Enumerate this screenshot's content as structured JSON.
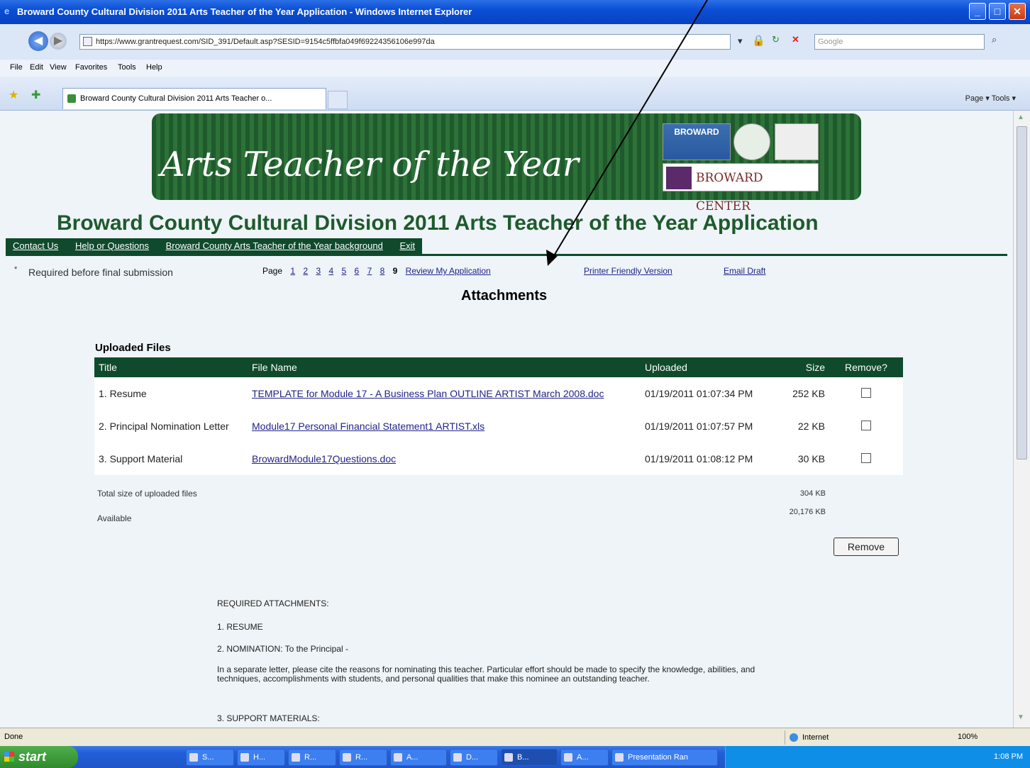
{
  "window": {
    "title": "Broward County Cultural Division 2011 Arts Teacher of the Year Application - Windows Internet Explorer",
    "minimize": "_",
    "maximize": "□",
    "close": "✕"
  },
  "browser": {
    "back": "◀",
    "forward": "▶",
    "url": "https://www.grantrequest.com/SID_391/Default.asp?SESID=9154c5ffbfa049f69224356106e997da",
    "search_placeholder": "Google",
    "menu": [
      "File",
      "Edit",
      "View",
      "Favorites",
      "Tools",
      "Help"
    ],
    "tab_title": "Broward County Cultural Division 2011 Arts Teacher o...",
    "command_bar": "Page ▾   Tools ▾"
  },
  "banner": {
    "title": "Arts Teacher of the Year",
    "logo_broward": "BROWARD",
    "logo_center": "BROWARD CENTER"
  },
  "heading": "Broward County Cultural Division 2011 Arts Teacher of the Year Application",
  "topnav": [
    "Contact Us",
    "Help or Questions",
    "Broward County Arts Teacher of the Year background",
    "Exit"
  ],
  "required_note": "Required before final submission",
  "required_star": "*",
  "pager": {
    "label": "Page",
    "pages": [
      "1",
      "2",
      "3",
      "4",
      "5",
      "6",
      "7",
      "8"
    ],
    "current": "9",
    "review": "Review My Application"
  },
  "printer_friendly": "Printer Friendly Version",
  "email_draft": "Email Draft",
  "section_title": "Attachments",
  "uploaded": {
    "heading": "Uploaded Files",
    "columns": [
      "Title",
      "File Name",
      "Uploaded",
      "Size",
      "Remove?"
    ],
    "rows": [
      {
        "title": "1. Resume",
        "file": "TEMPLATE for Module 17 - A Business Plan OUTLINE ARTIST March 2008.doc",
        "uploaded": "01/19/2011 01:07:34 PM",
        "size": "252 KB"
      },
      {
        "title": "2. Principal Nomination Letter",
        "file": "Module17 Personal Financial Statement1 ARTIST.xls",
        "uploaded": "01/19/2011 01:07:57 PM",
        "size": "22 KB"
      },
      {
        "title": "3. Support Material",
        "file": "BrowardModule17Questions.doc",
        "uploaded": "01/19/2011 01:08:12 PM",
        "size": "30 KB"
      }
    ],
    "total_label": "Total size of uploaded files",
    "total_value": "304 KB",
    "available_label": "Available",
    "available_value": "20,176 KB",
    "remove_button": "Remove"
  },
  "instructions": {
    "heading": "REQUIRED ATTACHMENTS:",
    "item1": "1. RESUME",
    "item2": "2. NOMINATION: To the Principal -",
    "paragraph": "In a separate letter, please cite the reasons for nominating this teacher. Particular effort should be made to specify the knowledge, abilities, and techniques, accomplishments with students, and personal qualities that make this nominee an outstanding teacher.",
    "item3": "3. SUPPORT MATERIALS:"
  },
  "status": {
    "left": "Done",
    "zone": "Internet",
    "zoom": "100%"
  },
  "taskbar": {
    "start": "start",
    "buttons": [
      "S...",
      "H...",
      "R...",
      "R...",
      "A...",
      "D...",
      "B...",
      "A...",
      "Presentation Ran"
    ],
    "clock": "1:08 PM"
  }
}
